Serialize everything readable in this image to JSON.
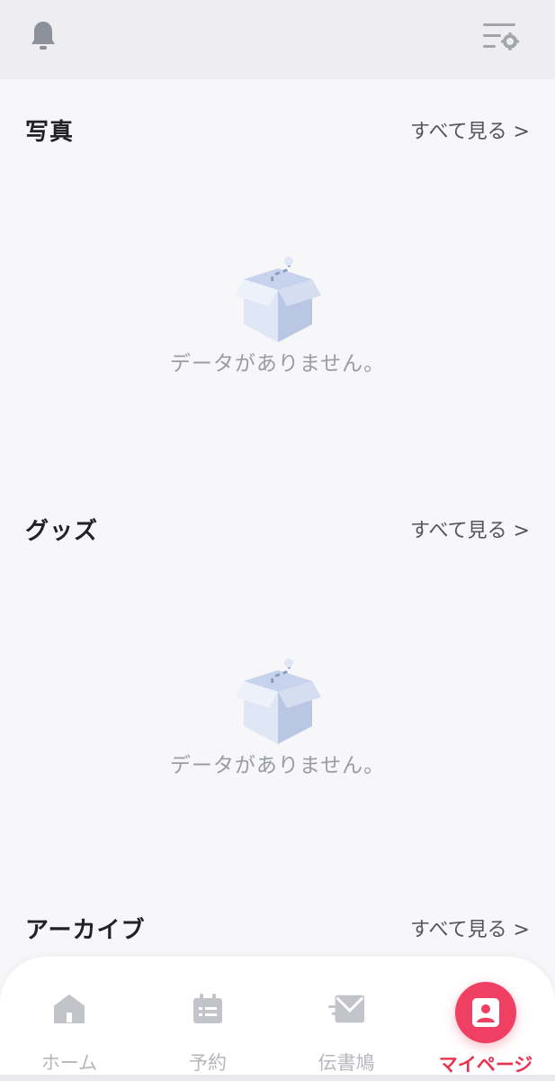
{
  "header": {
    "notification_icon": "bell-icon",
    "settings_icon": "list-settings-icon"
  },
  "sections": [
    {
      "title": "写真",
      "see_all": "すべて見る >",
      "empty_text": "データがありません。"
    },
    {
      "title": "グッズ",
      "see_all": "すべて見る >",
      "empty_text": "データがありません。"
    },
    {
      "title": "アーカイブ",
      "see_all": "すべて見る >"
    }
  ],
  "tabbar": {
    "items": [
      {
        "label": "ホーム",
        "icon": "home-icon"
      },
      {
        "label": "予約",
        "icon": "calendar-icon"
      },
      {
        "label": "伝書鳩",
        "icon": "mail-icon"
      },
      {
        "label": "マイページ",
        "icon": "profile-icon",
        "active": true
      }
    ]
  },
  "colors": {
    "accent": "#ef3f62",
    "active_label": "#e8344f",
    "inactive": "#b6b7bd",
    "empty_text": "#9a9ca4"
  }
}
